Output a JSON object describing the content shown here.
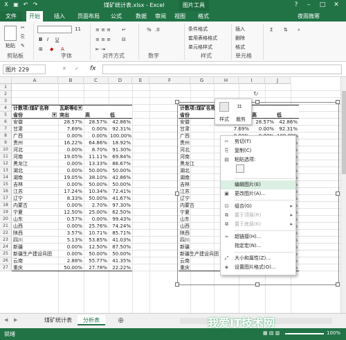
{
  "window": {
    "title": "煤矿统计表.xlsx - Excel",
    "picture_tools": "图片工具",
    "user": "夜雨微寒"
  },
  "tabs": [
    "文件",
    "开始",
    "插入",
    "页面布局",
    "公式",
    "数据",
    "审阅",
    "视图",
    "格式"
  ],
  "ribbon": {
    "groups": [
      "剪贴板",
      "字体",
      "对齐方式",
      "数字",
      "样式",
      "单元格"
    ],
    "font_size": "11",
    "styles": [
      "条件格式",
      "套用表格格式",
      "单元格样式"
    ],
    "cells": [
      "插入",
      "删除",
      "格式"
    ],
    "paste": "粘贴"
  },
  "formula_bar": {
    "name_box": "图片 229",
    "fx": "fx"
  },
  "columns": [
    "A",
    "B",
    "C",
    "D",
    "E",
    "F",
    "G",
    "H",
    "I",
    "J"
  ],
  "rows": [
    "1",
    "2",
    "3",
    "4",
    "5",
    "6",
    "7",
    "8",
    "9",
    "10",
    "11",
    "12",
    "13",
    "14",
    "15",
    "16",
    "17",
    "18",
    "19",
    "20",
    "21",
    "22",
    "23",
    "24",
    "25",
    "26",
    "27"
  ],
  "pivot": {
    "header1": "计数项:煤矿名称",
    "filter_label": "瓦斯等级",
    "col_prov": "省份",
    "col_out": "突出",
    "col_high": "高",
    "col_low": "低",
    "rows": [
      [
        "安徽",
        "28.57%",
        "28.57%",
        "42.86%"
      ],
      [
        "甘肃",
        "7.69%",
        "0.00%",
        "92.31%"
      ],
      [
        "广西",
        "0.00%",
        "0.00%",
        "100.00%"
      ],
      [
        "贵州",
        "16.22%",
        "64.86%",
        "18.92%"
      ],
      [
        "河北",
        "0.00%",
        "8.70%",
        "91.30%"
      ],
      [
        "河南",
        "19.05%",
        "11.11%",
        "69.84%"
      ],
      [
        "黑龙江",
        "0.00%",
        "13.33%",
        "86.67%"
      ],
      [
        "湖北",
        "0.00%",
        "50.00%",
        "50.00%"
      ],
      [
        "湖南",
        "19.05%",
        "38.10%",
        "42.86%"
      ],
      [
        "吉林",
        "0.00%",
        "50.00%",
        "50.00%"
      ],
      [
        "江苏",
        "17.24%",
        "10.34%",
        "72.41%"
      ],
      [
        "辽宁",
        "8.33%",
        "50.00%",
        "41.67%"
      ],
      [
        "内蒙古",
        "0.00%",
        "2.70%",
        "97.30%"
      ],
      [
        "宁夏",
        "12.50%",
        "25.00%",
        "62.50%"
      ],
      [
        "山东",
        "0.57%",
        "0.00%",
        "99.43%"
      ],
      [
        "山西",
        "0.00%",
        "25.76%",
        "74.24%"
      ],
      [
        "陕西",
        "3.57%",
        "10.71%",
        "85.71%"
      ],
      [
        "四川",
        "5.13%",
        "53.85%",
        "41.03%"
      ],
      [
        "新疆",
        "0.00%",
        "12.50%",
        "87.50%"
      ],
      [
        "新疆生产建设兵团",
        "0.00%",
        "50.00%",
        "50.00%"
      ],
      [
        "云南",
        "2.88%",
        "55.77%",
        "41.35%"
      ],
      [
        "重庆",
        "50.00%",
        "27.78%",
        "22.22%"
      ]
    ]
  },
  "minitoolbar": {
    "style": "样式",
    "crop": "裁剪"
  },
  "context_menu": [
    {
      "label": "剪切(T)",
      "icon": "cut-icon",
      "disabled": false
    },
    {
      "label": "复制(C)",
      "icon": "copy-icon",
      "disabled": false
    },
    {
      "label": "粘贴选项:",
      "icon": "paste-icon",
      "disabled": false
    },
    {
      "label": "编辑图片(E)",
      "icon": "",
      "disabled": false
    },
    {
      "label": "更改图片(A)...",
      "icon": "change-picture-icon",
      "disabled": false
    },
    {
      "label": "组合(G)",
      "icon": "group-icon",
      "disabled": false,
      "submenu": true
    },
    {
      "label": "置于顶层(R)",
      "icon": "bring-front-icon",
      "disabled": true,
      "submenu": true
    },
    {
      "label": "置于底层(K)",
      "icon": "send-back-icon",
      "disabled": true,
      "submenu": true
    },
    {
      "label": "超链接(H)...",
      "icon": "link-icon",
      "disabled": false
    },
    {
      "label": "指定宏(N)...",
      "icon": "",
      "disabled": false
    },
    {
      "label": "大小和属性(Z)...",
      "icon": "size-icon",
      "disabled": false
    },
    {
      "label": "设置图片格式(O)...",
      "icon": "format-picture-icon",
      "disabled": false
    }
  ],
  "sheets": [
    "煤矿统计表",
    "分析表"
  ],
  "status": {
    "left": "就绪",
    "zoom": "100%"
  },
  "watermark": "我爱IT技术网"
}
